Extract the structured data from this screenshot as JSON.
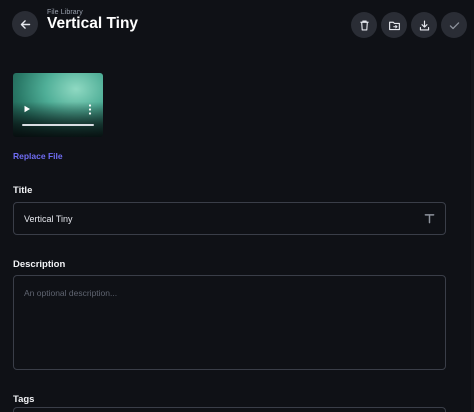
{
  "header": {
    "eyebrow": "File Library",
    "title": "Vertical Tiny",
    "back_icon": "arrow-left-icon",
    "actions": [
      {
        "icon": "trash-icon"
      },
      {
        "icon": "folder-move-icon"
      },
      {
        "icon": "download-icon"
      },
      {
        "icon": "check-icon"
      }
    ]
  },
  "media": {
    "replace_label": "Replace File",
    "play_icon": "play-icon",
    "menu_icon": "more-vertical-icon"
  },
  "form": {
    "title_label": "Title",
    "title_value": "Vertical Tiny",
    "title_icon": "text-type-icon",
    "description_label": "Description",
    "description_placeholder": "An optional description...",
    "tags_label": "Tags"
  },
  "colors": {
    "background": "#0f1116",
    "accent": "#6f6cf2",
    "button_bg": "#2a2d35",
    "border": "#3a3e48"
  }
}
